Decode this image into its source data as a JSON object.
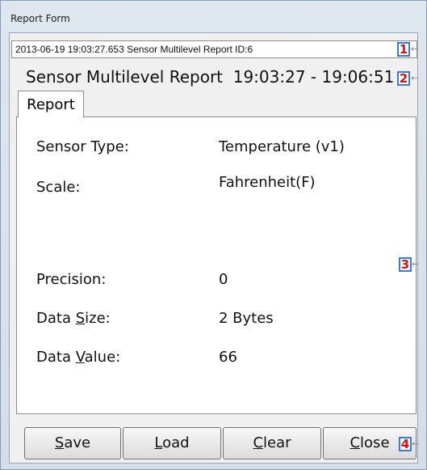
{
  "window": {
    "title": "Report Form"
  },
  "report_selector": {
    "value": "2013-06-19 19:03:27.653 Sensor Multilevel Report  ID:6"
  },
  "heading": {
    "title": "Sensor Multilevel Report",
    "time_range": "19:03:27 - 19:06:51"
  },
  "tabs": [
    {
      "label": "Report"
    }
  ],
  "fields": [
    {
      "label": "Sensor Type:",
      "value": "Temperature (v1)"
    },
    {
      "label": "Scale:",
      "value": "Fahrenheit(F)"
    },
    {
      "label": "Precision:",
      "value": "0"
    },
    {
      "label": "Data Size:",
      "label_pre": "Data ",
      "label_mnemonic": "S",
      "label_post": "ize:",
      "value": "2 Bytes"
    },
    {
      "label": "Data Value:",
      "label_pre": "Data ",
      "label_mnemonic": "V",
      "label_post": "alue:",
      "value": "66"
    }
  ],
  "buttons": {
    "save": {
      "mnemonic": "S",
      "rest": "ave"
    },
    "load": {
      "mnemonic": "L",
      "rest": "oad"
    },
    "clear": {
      "mnemonic": "C",
      "rest": "lear"
    },
    "close": {
      "mnemonic": "C",
      "rest": "lose"
    }
  },
  "markers": [
    "1",
    "2",
    "3",
    "4"
  ],
  "colors": {
    "marker_text": "#e01010",
    "marker_border": "#3a7bd5"
  }
}
